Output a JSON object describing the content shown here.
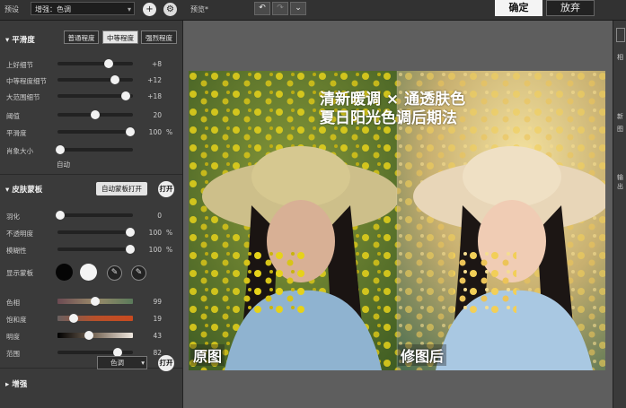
{
  "topbar": {
    "preset_label": "预设",
    "preset_value": "增强：色调",
    "preview_label": "预览*",
    "confirm": "确定",
    "cancel": "放弃",
    "add_icon": "+",
    "gear_icon": "⚙",
    "undo_icon": "↶",
    "redo_icon": "↷",
    "dropdown_icon": "⌄"
  },
  "feather": {
    "title": "平滑度",
    "modes": [
      "普通程度",
      "中等程度",
      "强烈程度"
    ],
    "active_mode": 1,
    "rows": [
      {
        "label": "上好细节",
        "value": "+8",
        "unit": "",
        "level": 0.68
      },
      {
        "label": "中等程度细节",
        "value": "+12",
        "unit": "",
        "level": 0.76
      },
      {
        "label": "大范围细节",
        "value": "+18",
        "unit": "",
        "level": 0.9
      },
      {
        "label": "阈值",
        "value": "20",
        "unit": "",
        "level": 0.5
      },
      {
        "label": "平滑度",
        "value": "100",
        "unit": "%",
        "level": 0.96
      },
      {
        "label": "肖象大小",
        "value": "",
        "unit": "",
        "level": 0.04
      }
    ],
    "auto_label": "自动"
  },
  "skinmask": {
    "title": "皮肤蒙板",
    "auto_btn": "自动蒙板打开",
    "toggle": "打开",
    "rows": [
      {
        "label": "羽化",
        "value": "0",
        "unit": "",
        "level": 0.04
      },
      {
        "label": "不透明度",
        "value": "100",
        "unit": "%",
        "level": 0.96
      },
      {
        "label": "模糊性",
        "value": "100",
        "unit": "%",
        "level": 0.96
      }
    ],
    "display_mask": "显示蒙板",
    "color_rows": [
      {
        "label": "色相",
        "value": "99",
        "level": 0.5
      },
      {
        "label": "饱和度",
        "value": "19",
        "level": 0.22
      },
      {
        "label": "明度",
        "value": "43",
        "level": 0.42
      },
      {
        "label": "范围",
        "value": "82",
        "level": 0.8
      }
    ]
  },
  "enhance": {
    "title": "增强",
    "select": "色调",
    "toggle": "打开"
  },
  "overlay": {
    "line1": "清新暖调 × 通透肤色",
    "line2": "夏日阳光色调后期法",
    "before": "原图",
    "after": "修图后"
  },
  "right_strip": {
    "t1": "相",
    "t2": "新",
    "t3": "图",
    "t4": "输出"
  },
  "colors": {
    "accent": "#e6e6e6",
    "panel": "#3a3a3a",
    "canvas": "#5e5e5e"
  }
}
